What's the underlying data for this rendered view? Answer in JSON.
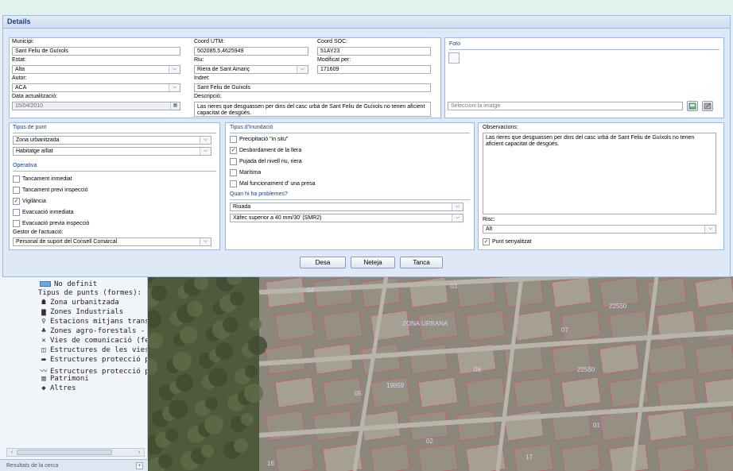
{
  "window": {
    "title": "Details"
  },
  "top": {
    "municipi": {
      "label": "Municipi:",
      "value": "Sant Feliu de Guíxols"
    },
    "estat": {
      "label": "Estat:",
      "value": "Alta"
    },
    "autor": {
      "label": "Autor:",
      "value": "ACA"
    },
    "data_actualitzacio": {
      "label": "Data actualització:",
      "value": "15/04/2010"
    },
    "coord_utm": {
      "label": "Coord UTM:",
      "value": "502085.5,4625949"
    },
    "riu": {
      "label": "Riu:",
      "value": "Riera de Sant Amanç"
    },
    "indret": {
      "label": "Indret:",
      "value": "Sant Feliu de Guíxols"
    },
    "descripcio": {
      "label": "Descripció:",
      "value": "Las rieres que desguassen per dins del casc urbà de Sant Feliu de Guíxols no tenen aficient capacitat de desgüés."
    },
    "coord_soc": {
      "label": "Coord SOC:",
      "value": "51AY23"
    },
    "modificat_per": {
      "label": "Modificat per:",
      "value": "171609"
    }
  },
  "foto": {
    "label": "Foto",
    "placeholder": "Seleccioni la imatge"
  },
  "tipus_punt": {
    "label": "Tipus de punt",
    "value1": "Zona urbanitzada",
    "value2": "Habitatge aïllat"
  },
  "operativa": {
    "label": "Operativa",
    "items": [
      {
        "label": "Tancament inmediat",
        "checked": false
      },
      {
        "label": "Tancament previ inspecció",
        "checked": false
      },
      {
        "label": "Vigilància",
        "checked": true
      },
      {
        "label": "Evacuació inmediata",
        "checked": false
      },
      {
        "label": "Evacuació previa inspecció",
        "checked": false
      }
    ],
    "gestor_label": "Gestor de l'actuació:",
    "gestor_value": "Personal de suport del Consell Comarcal"
  },
  "inundacio": {
    "label": "Tipus d'Inundació",
    "items": [
      {
        "label": "Precipitació \"in situ\"",
        "checked": false
      },
      {
        "label": "Desbordament de la llera",
        "checked": true
      },
      {
        "label": "Pujada del nivell riu, riera",
        "checked": false
      },
      {
        "label": "Marítima",
        "checked": false
      },
      {
        "label": "Mal funcionament d' una presa",
        "checked": false
      }
    ],
    "problemes_label": "Quan hi ha problemes?",
    "problemes_value1": "Riuada",
    "problemes_value2": "Xàfec superior a 40 mm/30' (SMR2)"
  },
  "observacions": {
    "label": "Observacions:",
    "value": "Las rieres que desguassen per dins del casc urbà de Sant Feliu de Guíxols no tenen aficient capacitat de desgüés."
  },
  "risc": {
    "label": "Risc:",
    "value": "Alt"
  },
  "punt_senyalitzat": {
    "label": "Punt senyalitzat",
    "checked": true
  },
  "buttons": {
    "save": "Desa",
    "clear": "Neteja",
    "close": "Tanca"
  },
  "legend": {
    "no_definit": "No definit",
    "title": "Tipus de punts (formes):",
    "items": [
      {
        "icon": "house-icon",
        "label": "Zona urbanitzada"
      },
      {
        "icon": "factory-icon",
        "label": "Zones Industrials"
      },
      {
        "icon": "station-icon",
        "label": "Estacions mitjans trans"
      },
      {
        "icon": "tree-icon",
        "label": "Zones agro-forestals -"
      },
      {
        "icon": "road-icon",
        "label": "Vies de comunicació (fe"
      },
      {
        "icon": "structure-icon",
        "label": "Estructures de les vies"
      },
      {
        "icon": "protection-icon",
        "label": "Estructures protecció p"
      },
      {
        "icon": "wave-icon",
        "label": "Estructures protecció p"
      },
      {
        "icon": "heritage-icon",
        "label": "Patrimoni"
      },
      {
        "icon": "diamond-icon",
        "label": "Altres"
      }
    ]
  },
  "results": {
    "label": "Resultats de la cerca"
  },
  "map_labels": [
    "ZONA URBANA",
    "04",
    "03",
    "05",
    "06",
    "07",
    "01",
    "02",
    "16",
    "22550",
    "22580",
    "19859",
    "17"
  ]
}
